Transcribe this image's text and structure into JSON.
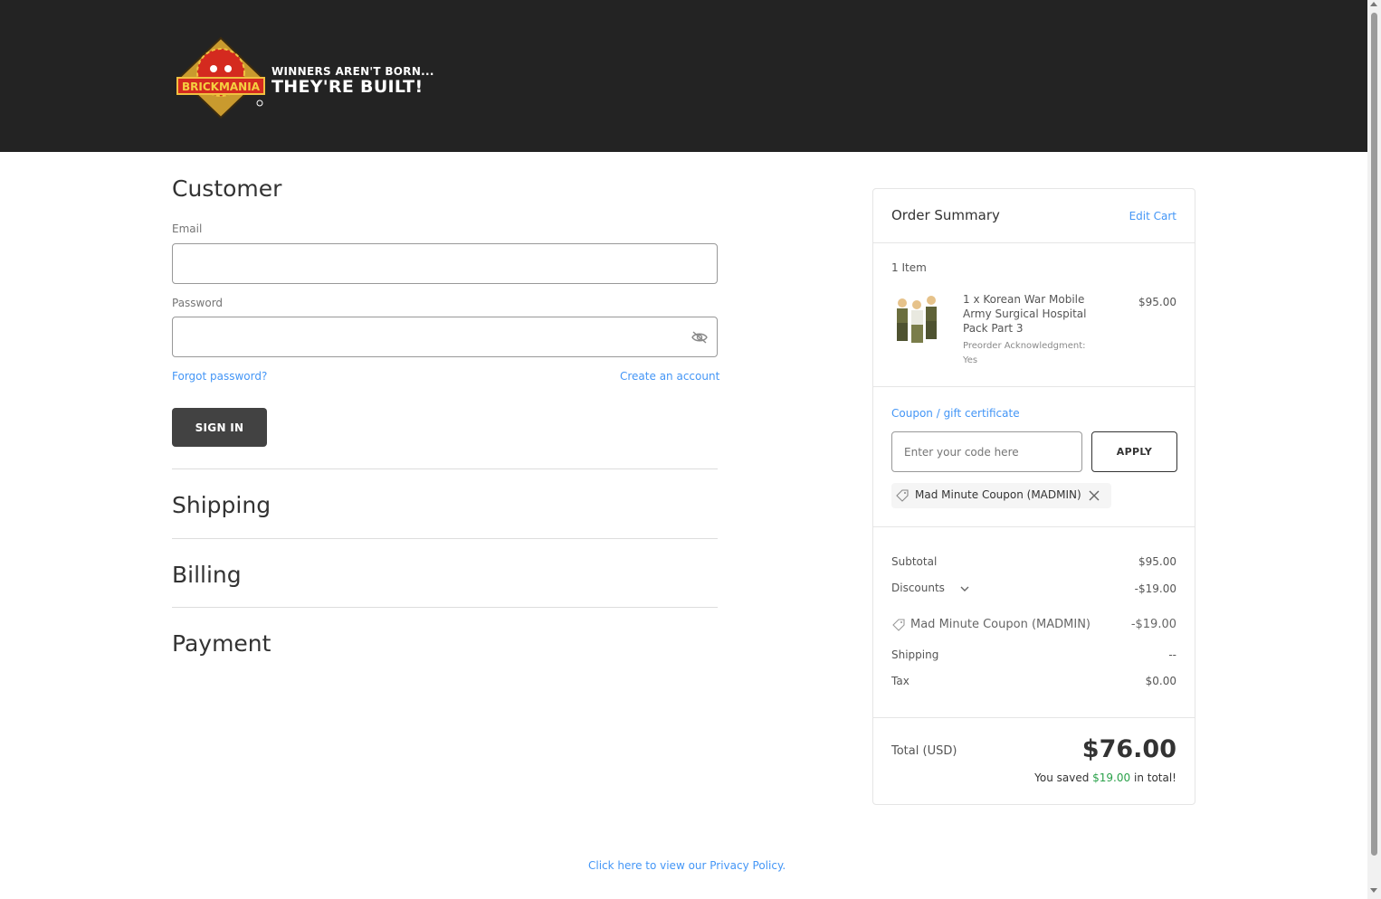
{
  "header": {
    "logo_badge_text": "BRICKMANIA",
    "tagline_line1": "WINNERS AREN'T BORN...",
    "tagline_line2": "THEY'RE BUILT!"
  },
  "customer": {
    "heading": "Customer",
    "email_label": "Email",
    "email_value": "",
    "password_label": "Password",
    "password_value": "",
    "forgot_password": "Forgot password?",
    "create_account": "Create an account",
    "sign_in": "SIGN IN"
  },
  "sections": {
    "shipping": "Shipping",
    "billing": "Billing",
    "payment": "Payment"
  },
  "order_summary": {
    "title": "Order Summary",
    "edit_cart": "Edit Cart",
    "item_count": "1 Item",
    "item": {
      "name": "1 x Korean War Mobile Army Surgical Hospital Pack Part 3",
      "option": "Preorder Acknowledgment: Yes",
      "price": "$95.00"
    },
    "coupon_link": "Coupon / gift certificate",
    "coupon_placeholder": "Enter your code here",
    "apply": "APPLY",
    "applied_coupon": "Mad Minute Coupon (MADMIN)",
    "subtotal_label": "Subtotal",
    "subtotal_value": "$95.00",
    "discounts_label": "Discounts",
    "discounts_value": "-$19.00",
    "discount_line_name": "Mad Minute Coupon (MADMIN)",
    "discount_line_value": "-$19.00",
    "shipping_label": "Shipping",
    "shipping_value": "--",
    "tax_label": "Tax",
    "tax_value": "$0.00",
    "total_label": "Total (USD)",
    "total_value": "$76.00",
    "saved_prefix": "You saved",
    "saved_amount": "$19.00",
    "saved_suffix": "in total!"
  },
  "footer": {
    "privacy_link": "Click here to view our Privacy Policy."
  },
  "icons": [
    "eye-slash-icon",
    "tag-icon",
    "close-icon",
    "chevron-down-icon",
    "brickmania-logo"
  ],
  "colors": {
    "header_bg": "#232323",
    "link": "#4496f6",
    "button_dark": "#424242",
    "savings_green": "#2aa14a"
  }
}
